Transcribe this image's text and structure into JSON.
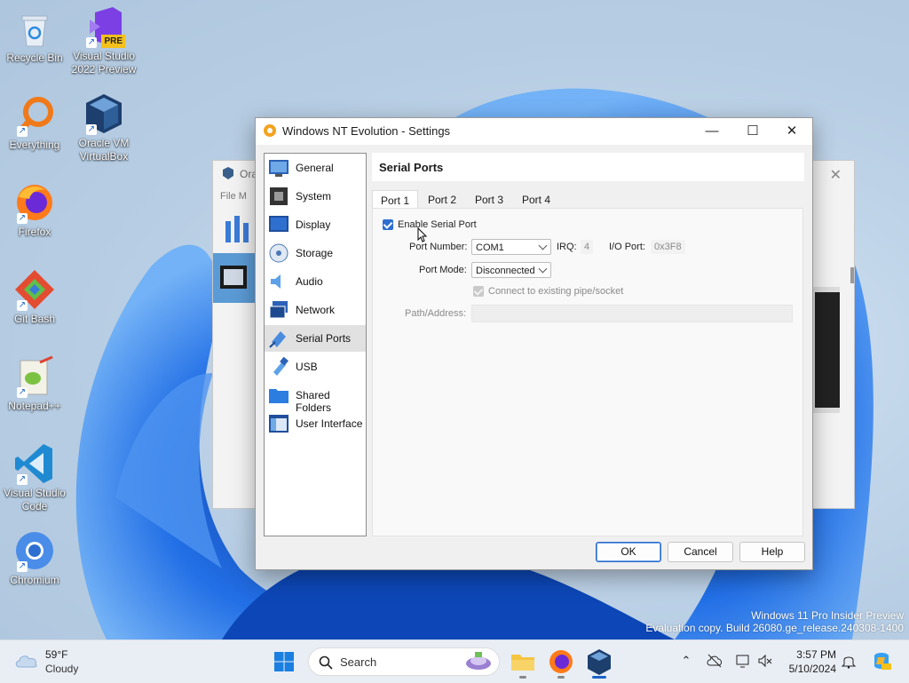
{
  "desktop": {
    "icons": [
      {
        "label": "Recycle Bin"
      },
      {
        "label": "Visual Studio 2022 Preview",
        "badge": "PRE"
      },
      {
        "label": "Everything"
      },
      {
        "label": "Oracle VM VirtualBox"
      },
      {
        "label": "Firefox"
      },
      {
        "label": "Git Bash"
      },
      {
        "label": "Notepad++"
      },
      {
        "label": "Visual Studio Code"
      },
      {
        "label": "Chromium"
      }
    ],
    "watermark": {
      "line1": "Windows 11 Pro Insider Preview",
      "line2": "Evaluation copy. Build 26080.ge_release.240308-1400"
    }
  },
  "background_window": {
    "title": "Ora",
    "menu": "File   M"
  },
  "dialog": {
    "title": "Windows NT Evolution - Settings",
    "controls": {
      "minimize": "—",
      "maximize": "☐",
      "close": "✕"
    },
    "nav": [
      {
        "label": "General",
        "icon": "general-icon"
      },
      {
        "label": "System",
        "icon": "system-icon"
      },
      {
        "label": "Display",
        "icon": "display-icon"
      },
      {
        "label": "Storage",
        "icon": "storage-icon"
      },
      {
        "label": "Audio",
        "icon": "audio-icon"
      },
      {
        "label": "Network",
        "icon": "network-icon"
      },
      {
        "label": "Serial Ports",
        "icon": "serial-ports-icon",
        "active": true
      },
      {
        "label": "USB",
        "icon": "usb-icon"
      },
      {
        "label": "Shared Folders",
        "icon": "shared-folders-icon"
      },
      {
        "label": "User Interface",
        "icon": "user-interface-icon"
      }
    ],
    "section_title": "Serial Ports",
    "tabs": [
      {
        "label": "Port 1",
        "active": true
      },
      {
        "label": "Port 2"
      },
      {
        "label": "Port 3"
      },
      {
        "label": "Port 4"
      }
    ],
    "form": {
      "enable_label": "Enable Serial Port",
      "enable_checked": true,
      "port_number_label": "Port Number:",
      "port_number_value": "COM1",
      "irq_label": "IRQ:",
      "irq_value": "4",
      "io_port_label": "I/O Port:",
      "io_port_value": "0x3F8",
      "port_mode_label": "Port Mode:",
      "port_mode_value": "Disconnected",
      "connect_existing_label": "Connect to existing pipe/socket",
      "connect_existing_checked": true,
      "connect_existing_disabled": true,
      "path_label": "Path/Address:",
      "path_value": ""
    },
    "buttons": {
      "ok": "OK",
      "cancel": "Cancel",
      "help": "Help"
    }
  },
  "taskbar": {
    "weather": {
      "temp": "59°F",
      "condition": "Cloudy"
    },
    "search_placeholder": "Search",
    "clock": {
      "time": "3:57 PM",
      "date": "5/10/2024"
    }
  },
  "colors": {
    "accent": "#2d6fd0",
    "selected_nav": "#e1e1e1",
    "taskbar": "#e9eef5"
  }
}
